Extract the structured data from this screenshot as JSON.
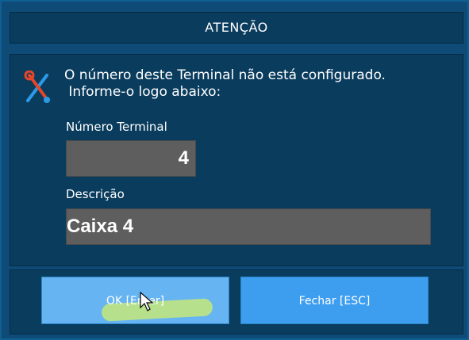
{
  "dialog": {
    "title": "ATENÇÃO",
    "message_line1": "O número deste Terminal não está configurado.",
    "message_line2": " Informe-o logo abaixo:",
    "icon": "tools-icon"
  },
  "form": {
    "terminal_label": "Número Terminal",
    "terminal_value": "4",
    "description_label": "Descrição",
    "description_value": "Caixa 4"
  },
  "buttons": {
    "ok_label": "OK [Enter]",
    "close_label": "Fechar [ESC]"
  },
  "colors": {
    "background": "#0d4a72",
    "panel": "#0a3c5e",
    "input": "#5e5e5e",
    "ok_button": "#66b4f1",
    "close_button": "#3d9ef0",
    "highlight": "#c6e77a"
  }
}
